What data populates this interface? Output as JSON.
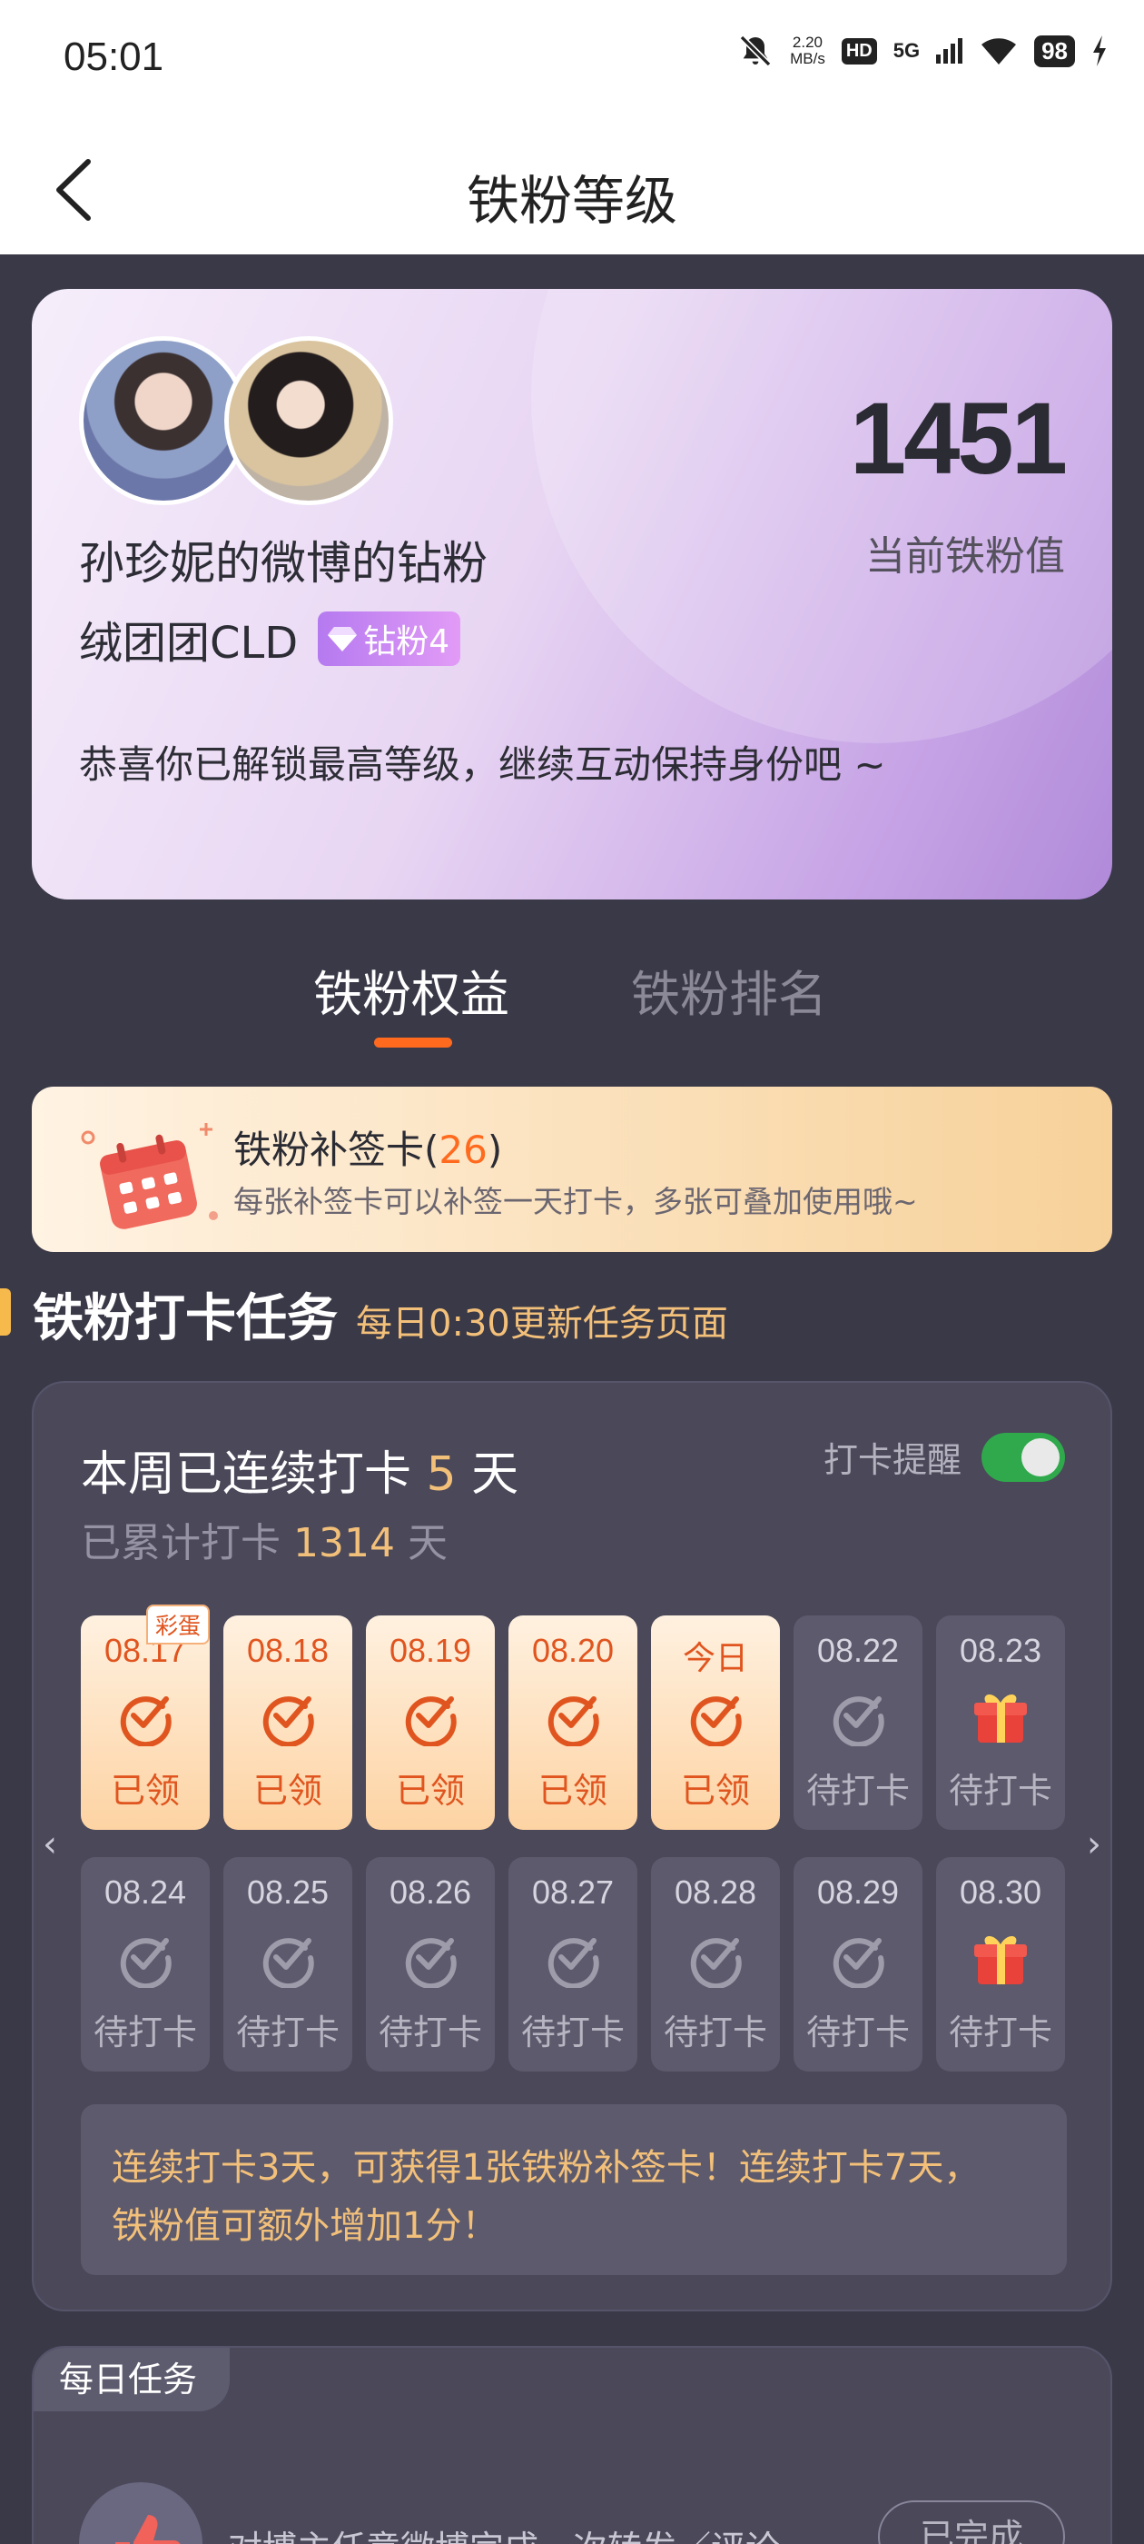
{
  "status_bar": {
    "time": "05:01",
    "net_speed_value": "2.20",
    "net_speed_unit": "MB/s",
    "hd_label": "HD",
    "signal_label": "5G",
    "battery": "98",
    "icons": [
      "mute-bell-icon",
      "wifi-icon",
      "charging-icon"
    ]
  },
  "header": {
    "title": "铁粉等级",
    "back_icon": "chevron-left-icon"
  },
  "profile": {
    "name_line": "孙珍妮的微博的钻粉",
    "group_name": "绒团团CLD",
    "badge_label": "钻粉4",
    "badge_icon": "diamond-icon",
    "message": "恭喜你已解锁最高等级，继续互动保持身份吧 ~",
    "score": "1451",
    "score_label": "当前铁粉值"
  },
  "tabs": [
    {
      "label": "铁粉权益",
      "active": true
    },
    {
      "label": "铁粉排名",
      "active": false
    }
  ],
  "makeup_card": {
    "title": "铁粉补签卡",
    "count": "26",
    "paren_open": "(",
    "paren_close": ")",
    "description": "每张补签卡可以补签一天打卡，多张可叠加使用哦~",
    "icon": "calendar-icon"
  },
  "checkin_section": {
    "title": "铁粉打卡任务",
    "subtitle": "每日0:30更新任务页面"
  },
  "checkin": {
    "streak_prefix": "本周已连续打卡",
    "streak_days": "5",
    "streak_suffix": "天",
    "total_prefix": "已累计打卡",
    "total_days": "1314",
    "total_suffix": "天",
    "reminder_label": "打卡提醒",
    "reminder_on": true,
    "egg_tag": "彩蛋",
    "days": [
      {
        "date": "08.17",
        "status": "已领",
        "state": "done",
        "icon": "check-circle-icon"
      },
      {
        "date": "08.18",
        "status": "已领",
        "state": "done",
        "icon": "check-circle-icon"
      },
      {
        "date": "08.19",
        "status": "已领",
        "state": "done",
        "icon": "check-circle-icon"
      },
      {
        "date": "08.20",
        "status": "已领",
        "state": "done",
        "icon": "check-circle-icon"
      },
      {
        "date": "今日",
        "status": "已领",
        "state": "done",
        "icon": "check-circle-icon"
      },
      {
        "date": "08.22",
        "status": "待打卡",
        "state": "pending",
        "icon": "check-circle-icon"
      },
      {
        "date": "08.23",
        "status": "待打卡",
        "state": "pending",
        "icon": "gift-icon"
      },
      {
        "date": "08.24",
        "status": "待打卡",
        "state": "pending",
        "icon": "check-circle-icon"
      },
      {
        "date": "08.25",
        "status": "待打卡",
        "state": "pending",
        "icon": "check-circle-icon"
      },
      {
        "date": "08.26",
        "status": "待打卡",
        "state": "pending",
        "icon": "check-circle-icon"
      },
      {
        "date": "08.27",
        "status": "待打卡",
        "state": "pending",
        "icon": "check-circle-icon"
      },
      {
        "date": "08.28",
        "status": "待打卡",
        "state": "pending",
        "icon": "check-circle-icon"
      },
      {
        "date": "08.29",
        "status": "待打卡",
        "state": "pending",
        "icon": "check-circle-icon"
      },
      {
        "date": "08.30",
        "status": "待打卡",
        "state": "pending",
        "icon": "gift-icon"
      }
    ],
    "nav_prev": "‹",
    "nav_next": "›",
    "rule_line1": "连续打卡3天，可获得1张铁粉补签卡！连续打卡7天，",
    "rule_line2": "铁粉值可额外增加1分！"
  },
  "daily_tasks": {
    "tag": "每日任务",
    "task_text": "对博主任意微博完成一次转发／评论",
    "task_button": "已完成",
    "task_icon": "thumbs-up-icon"
  },
  "colors": {
    "background": "#3a3948",
    "accent_orange": "#ff6a1f",
    "highlight_gold": "#f3c07a",
    "toggle_green": "#2fa94c"
  }
}
